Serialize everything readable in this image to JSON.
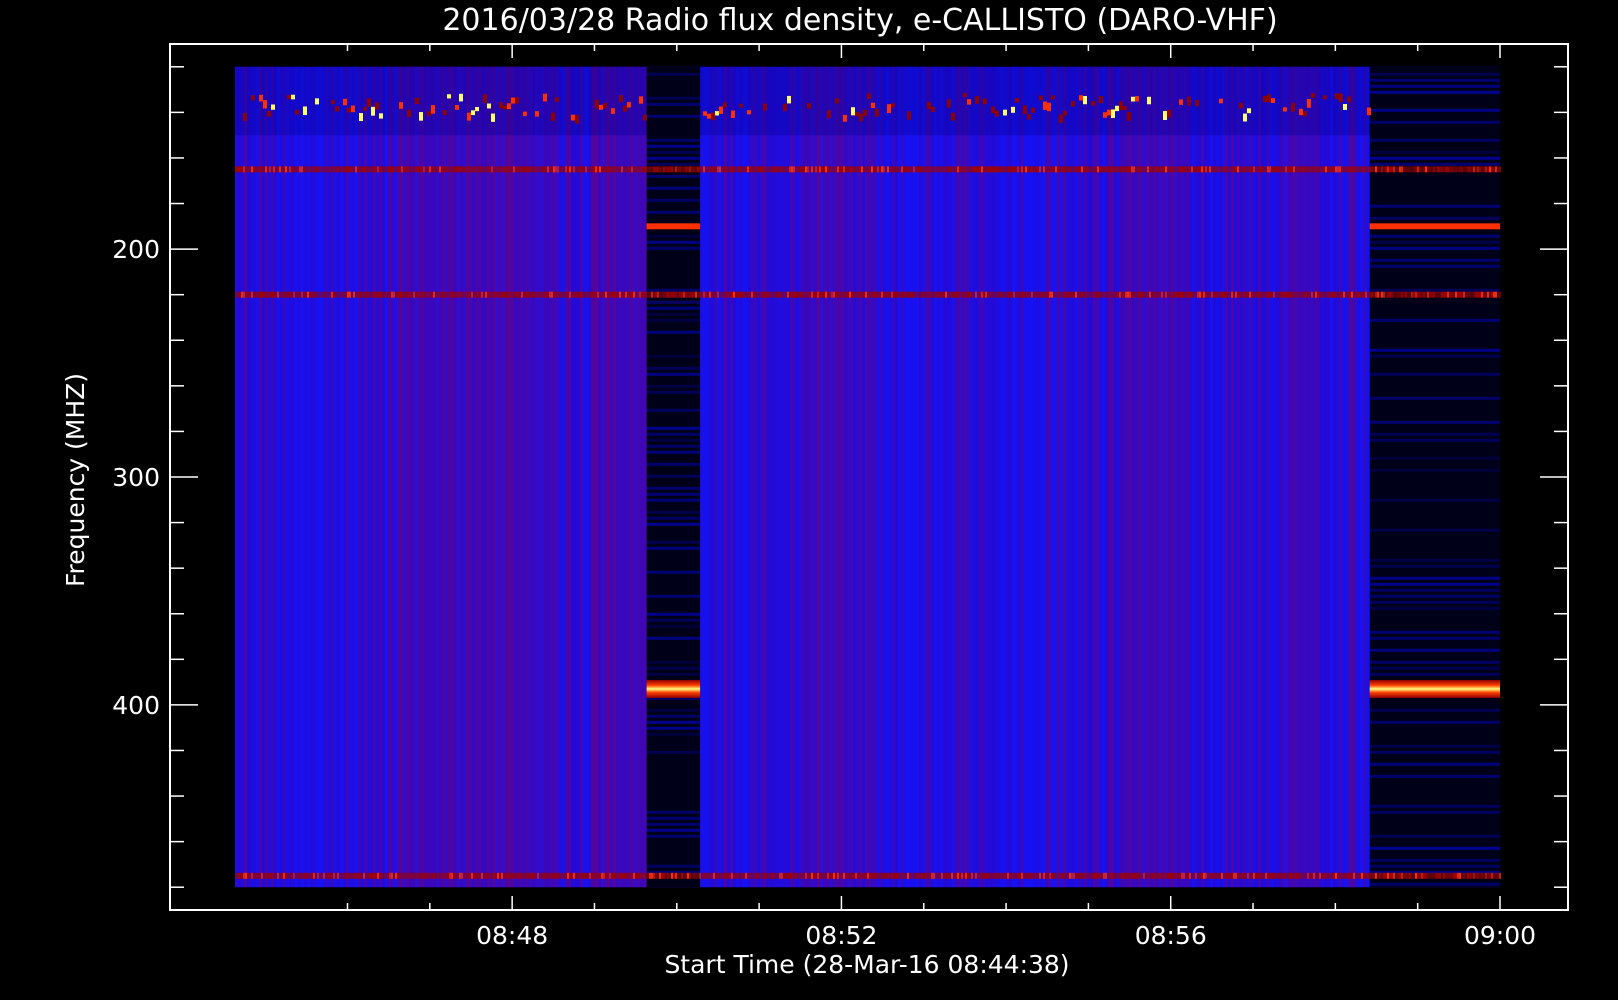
{
  "chart_data": {
    "type": "heatmap",
    "title": "2016/03/28  Radio flux density, e-CALLISTO (DARO-VHF)",
    "xlabel": "Start Time (28-Mar-16 08:44:38)",
    "ylabel": "Frequency (MHZ)",
    "x_ticks": [
      {
        "label": "08:48",
        "minutes": 48
      },
      {
        "label": "08:52",
        "minutes": 52
      },
      {
        "label": "08:56",
        "minutes": 56
      },
      {
        "label": "09:00",
        "minutes": 60
      }
    ],
    "y_ticks": [
      {
        "label": "200",
        "value": 200
      },
      {
        "label": "300",
        "value": 300
      },
      {
        "label": "400",
        "value": 400
      }
    ],
    "xlim": [
      "08:44:38",
      "09:00:00"
    ],
    "ylim": [
      110,
      490
    ],
    "y_axis_inverted": true,
    "data_time_range": [
      "08:44:38",
      "09:00:00"
    ],
    "data_freq_range": [
      120,
      480
    ],
    "colormap": [
      "#000000",
      "#0000ff",
      "#8b0000",
      "#ff3000",
      "#ffff66",
      "#ffffff"
    ],
    "background_level": "blue",
    "calibration_segments": [
      {
        "start": "08:49:38",
        "end": "08:50:17",
        "level": "dark"
      },
      {
        "start": "08:58:25",
        "end": "09:00:00",
        "level": "dark"
      }
    ],
    "bright_bands_mhz": [
      {
        "freq": 135,
        "level": "hot",
        "note": "intermittent RFI"
      },
      {
        "freq": 165,
        "level": "red",
        "note": "continuous line"
      },
      {
        "freq": 190,
        "level": "hot",
        "segments_only": true
      },
      {
        "freq": 220,
        "level": "red"
      },
      {
        "freq": 393,
        "level": "saturated",
        "segments_only": true
      },
      {
        "freq": 475,
        "level": "red"
      }
    ]
  }
}
